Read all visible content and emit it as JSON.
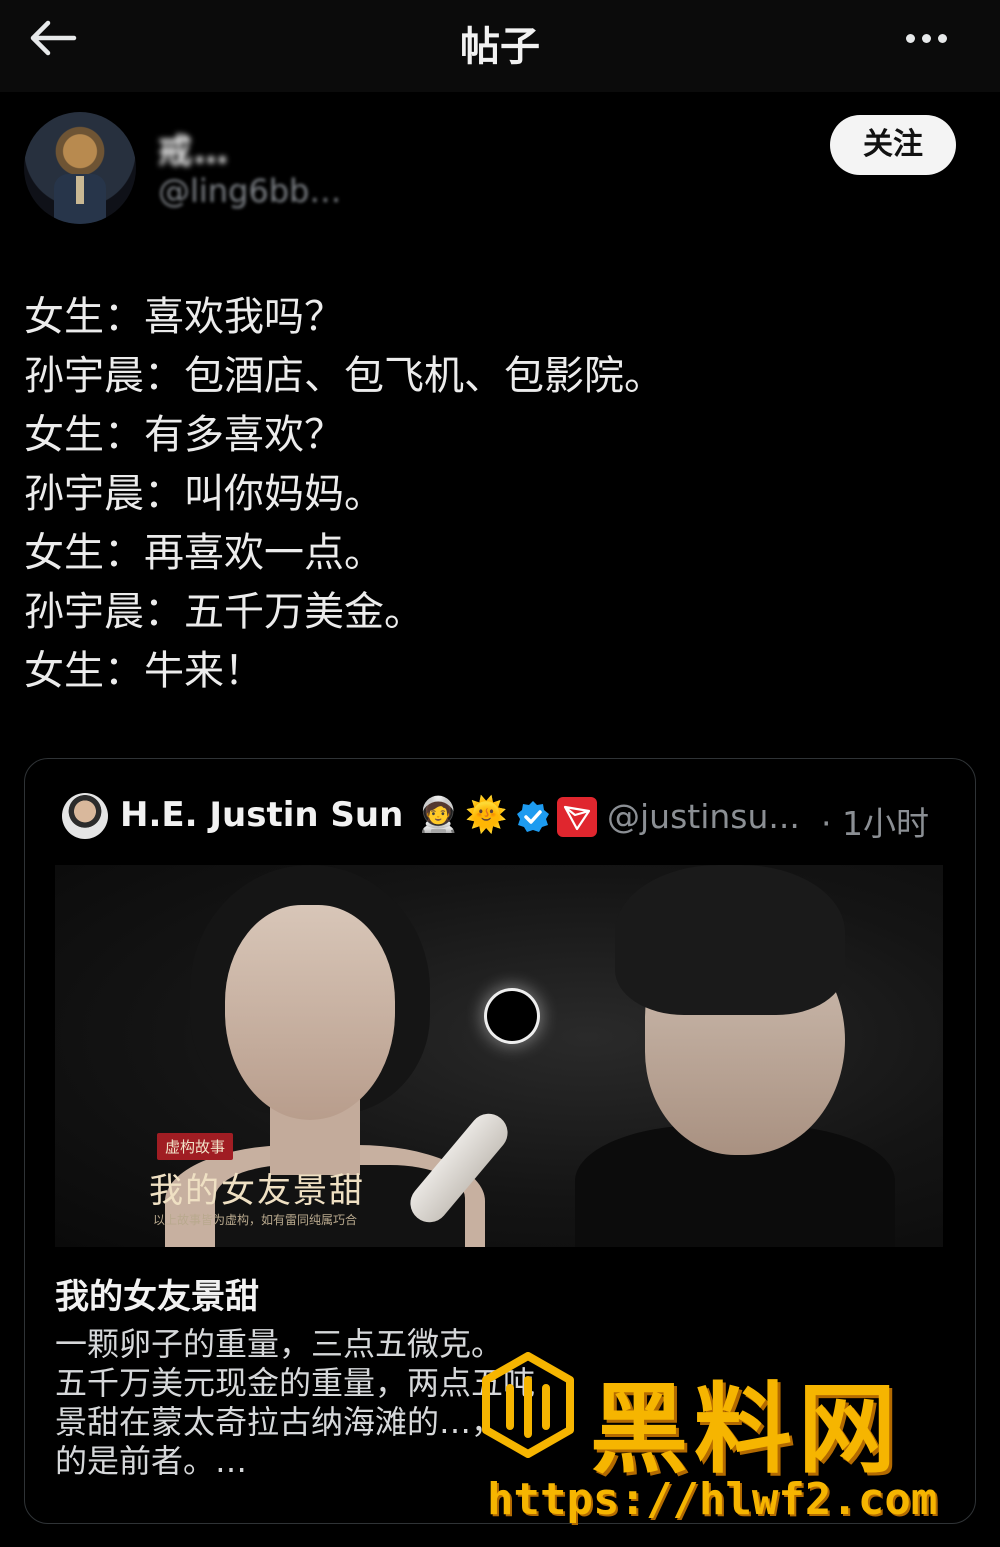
{
  "header": {
    "title": "帖子"
  },
  "author": {
    "display_name": "戒…",
    "handle": "@ling6bb…"
  },
  "follow_label": "关注",
  "post": {
    "lines": [
      "女生：喜欢我吗？",
      "孙宇晨：包酒店、包飞机、包影院。",
      "女生：有多喜欢？",
      "孙宇晨：叫你妈妈。",
      "女生：再喜欢一点。",
      "孙宇晨：五千万美金。",
      "女生：牛来！"
    ]
  },
  "quoted": {
    "name": "H.E. Justin Sun",
    "emoji_1": "🧑‍🚀",
    "emoji_2": "🌞",
    "handle": "@justinsu...",
    "time": "· 1小时",
    "media": {
      "tag": "虚构故事",
      "title": "我的女友景甜",
      "disclaimer": "以上故事皆为虚构，如有雷同纯属巧合"
    },
    "card_title": "我的女友景甜",
    "card_desc": [
      "一颗卵子的重量，三点五微克。",
      "五千万美元现金的重量，两点五吨",
      "景甜在蒙太奇拉古纳海滩的…，",
      "的是前者。…"
    ]
  },
  "watermark": {
    "name": "黑料网",
    "url": "https://hlwf2.com"
  },
  "colors": {
    "background": "#000000",
    "accent_verified": "#1d9bf0",
    "tron_red": "#e0262e",
    "watermark_gold": "#f6b500"
  },
  "icons": [
    "back-arrow-icon",
    "more-icon",
    "verified-icon",
    "tron-icon",
    "eclipse-icon",
    "watermark-logo-icon"
  ]
}
